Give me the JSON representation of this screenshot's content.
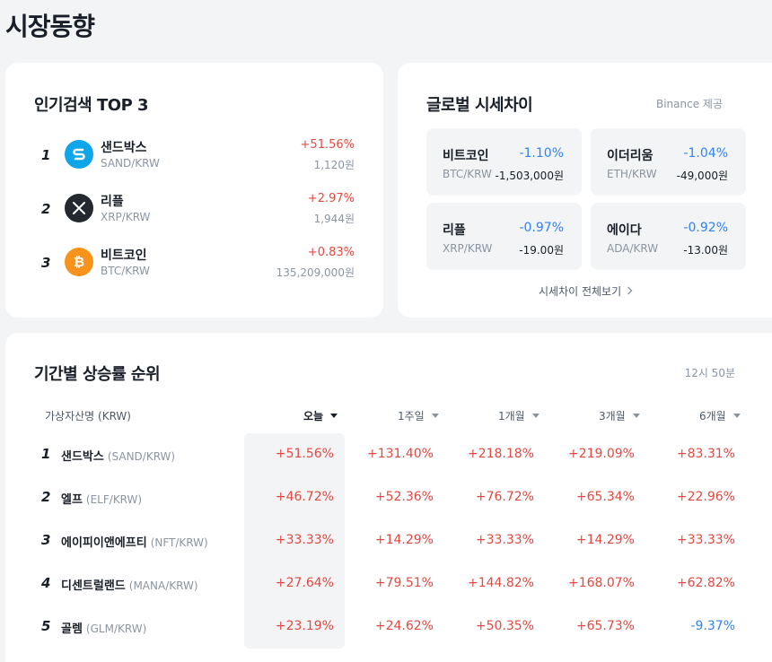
{
  "page_title": "시장동향",
  "popular": {
    "title": "인기검색 TOP 3",
    "items": [
      {
        "rank": "1",
        "name": "샌드박스",
        "pair": "SAND/KRW",
        "rate": "+51.56%",
        "price": "1,120원",
        "icon": "sandbox-logo-icon",
        "color": "#0ea5e9"
      },
      {
        "rank": "2",
        "name": "리플",
        "pair": "XRP/KRW",
        "rate": "+2.97%",
        "price": "1,944원",
        "icon": "ripple-logo-icon",
        "color": "#23292f"
      },
      {
        "rank": "3",
        "name": "비트코인",
        "pair": "BTC/KRW",
        "rate": "+0.83%",
        "price": "135,209,000원",
        "icon": "bitcoin-logo-icon",
        "color": "#f7931a"
      }
    ]
  },
  "global": {
    "title": "글로벌 시세차이",
    "provider": "Binance 제공",
    "items": [
      {
        "name": "비트코인",
        "rate": "-1.10%",
        "pair": "BTC/KRW",
        "diff": "-1,503,000원"
      },
      {
        "name": "이더리움",
        "rate": "-1.04%",
        "pair": "ETH/KRW",
        "diff": "-49,000원"
      },
      {
        "name": "리플",
        "rate": "-0.97%",
        "pair": "XRP/KRW",
        "diff": "-19.00원"
      },
      {
        "name": "에이다",
        "rate": "-0.92%",
        "pair": "ADA/KRW",
        "diff": "-13.00원"
      }
    ],
    "view_all": "시세차이 전체보기"
  },
  "ranking": {
    "title": "기간별 상승률 순위",
    "update_time": "12시 50분",
    "columns": [
      "가상자산명 (KRW)",
      "오늘",
      "1주일",
      "1개월",
      "3개월",
      "6개월"
    ],
    "active_column": "오늘",
    "rows": [
      {
        "rank": "1",
        "name": "샌드박스",
        "pair": "(SAND/KRW)",
        "values": [
          "+51.56%",
          "+131.40%",
          "+218.18%",
          "+219.09%",
          "+83.31%"
        ]
      },
      {
        "rank": "2",
        "name": "엘프",
        "pair": "(ELF/KRW)",
        "values": [
          "+46.72%",
          "+52.36%",
          "+76.72%",
          "+65.34%",
          "+22.96%"
        ]
      },
      {
        "rank": "3",
        "name": "에이피이앤에프티",
        "pair": "(NFT/KRW)",
        "values": [
          "+33.33%",
          "+14.29%",
          "+33.33%",
          "+14.29%",
          "+33.33%"
        ]
      },
      {
        "rank": "4",
        "name": "디센트럴랜드",
        "pair": "(MANA/KRW)",
        "values": [
          "+27.64%",
          "+79.51%",
          "+144.82%",
          "+168.07%",
          "+62.82%"
        ]
      },
      {
        "rank": "5",
        "name": "골렘",
        "pair": "(GLM/KRW)",
        "values": [
          "+23.19%",
          "+24.62%",
          "+50.35%",
          "+65.73%",
          "-9.37%"
        ]
      }
    ]
  },
  "colors": {
    "up": "#e5483f",
    "down": "#3182f6"
  }
}
